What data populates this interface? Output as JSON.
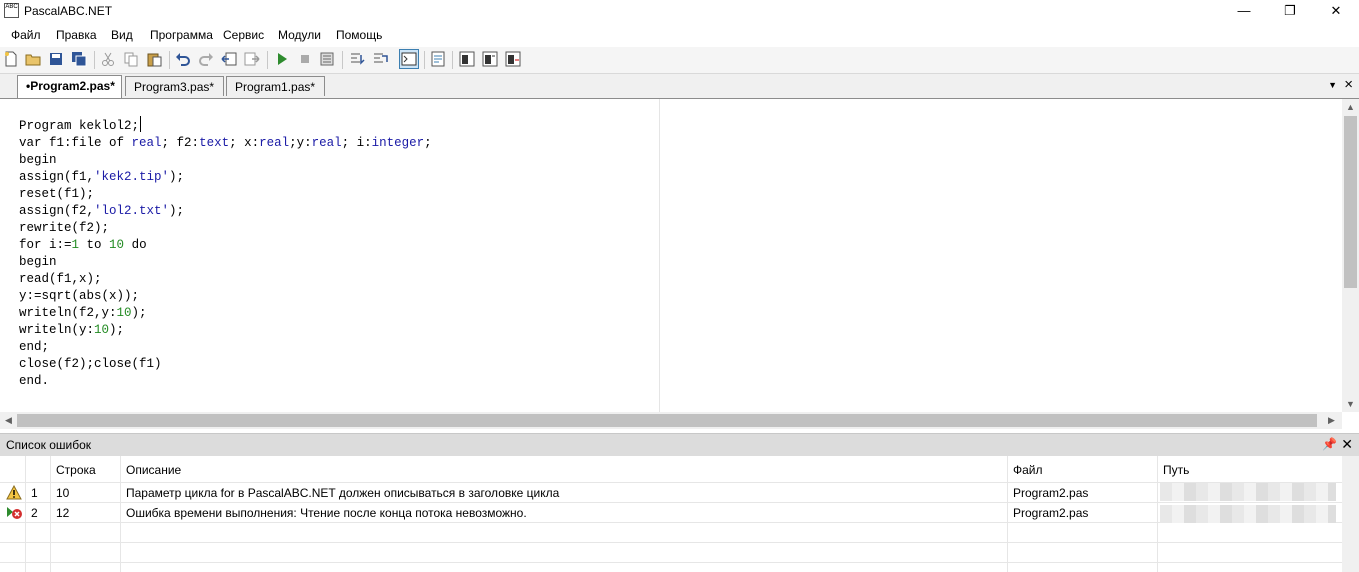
{
  "window": {
    "title": "PascalABC.NET",
    "icon_text": "ABC",
    "minimize": "—",
    "maximize": "❐",
    "close": "✕"
  },
  "menu": [
    "Файл",
    "Правка",
    "Вид",
    "Программа",
    "Сервис",
    "Модули",
    "Помощь"
  ],
  "tabs": [
    {
      "label": "•Program2.pas*",
      "active": true
    },
    {
      "label": "Program3.pas*",
      "active": false
    },
    {
      "label": "Program1.pas*",
      "active": false
    }
  ],
  "editor": {
    "lines": [
      "Program keklol2;",
      "var f1:file of real; f2:text; x:real;y:real; i:integer;",
      "begin",
      "assign(f1,'kek2.tip');",
      "reset(f1);",
      "assign(f2,'lol2.txt');",
      "rewrite(f2);",
      "for i:=1 to 10 do",
      "begin",
      "read(f1,x);",
      "y:=sqrt(abs(x));",
      "writeln(f2,y:10);",
      "writeln(y:10);",
      "end;",
      "close(f2);close(f1)",
      "end."
    ]
  },
  "error_panel": {
    "title": "Список ошибок",
    "columns": [
      "Строка",
      "Описание",
      "Файл",
      "Путь"
    ],
    "rows": [
      {
        "index": "1",
        "icon": "warning-icon",
        "line": "10",
        "description": "Параметр цикла for в PascalABC.NET должен описываться в заголовке цикла",
        "file": "Program2.pas"
      },
      {
        "index": "2",
        "icon": "error-icon",
        "line": "12",
        "description": "Ошибка времени выполнения: Чтение после конца потока невозможно.",
        "file": "Program2.pas"
      }
    ]
  }
}
